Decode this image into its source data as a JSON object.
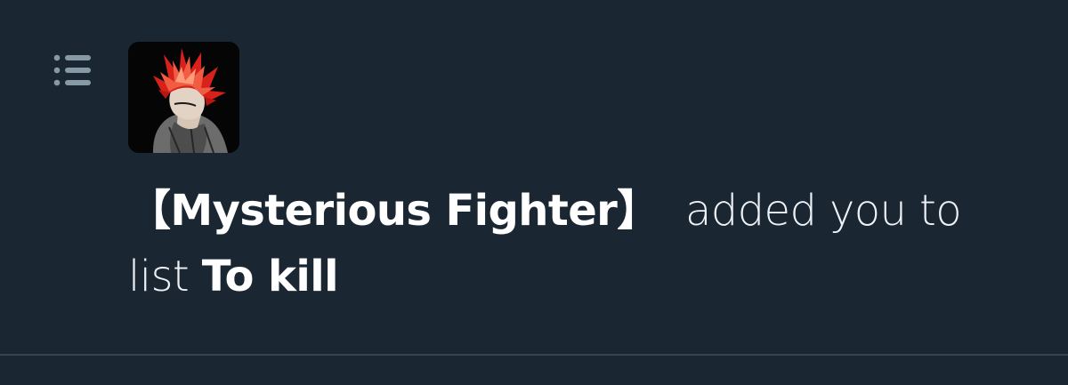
{
  "notification": {
    "icon": "list-icon",
    "avatar": "avatar-image",
    "actor_name": "【Mysterious Fighter】",
    "action_text": "added you to",
    "list_prefix": "list",
    "list_name": "To kill"
  },
  "colors": {
    "background": "#1b2633",
    "icon": "#8899a6",
    "text": "#f2f5f8",
    "divider": "#38444f"
  }
}
